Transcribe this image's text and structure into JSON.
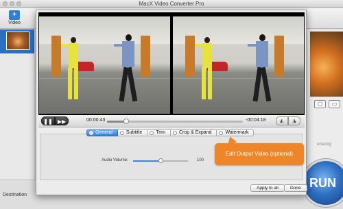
{
  "app": {
    "title": "MacX Video Converter Pro",
    "toolbar_video_label": "Video",
    "run_label": "RUN",
    "destination_label": "Destination",
    "deinterlacing_label": "erlacing"
  },
  "player": {
    "current_time": "00:00:43",
    "remaining_time": "-00:04:18",
    "progress": 0.14,
    "play_glyph": "❚❚",
    "forward_glyph": "▶▶",
    "rotate_glyph": "◭",
    "flip_glyph": "◮"
  },
  "tabs": [
    {
      "label": "General",
      "active": true
    },
    {
      "label": "Subtitle",
      "active": false
    },
    {
      "label": "Trim",
      "active": false
    },
    {
      "label": "Crop & Expand",
      "active": false
    },
    {
      "label": "Watermark",
      "active": false
    }
  ],
  "general": {
    "audio_volume_label": "Audio Volume:",
    "audio_volume_value": "100",
    "audio_volume_fraction": 0.5
  },
  "callout": {
    "text": "Edit Output Video (optional)"
  },
  "buttons": {
    "apply_all": "Apply to all",
    "done": "Done"
  },
  "colors": {
    "accent": "#2f7fe0",
    "callout": "#ee8627"
  }
}
